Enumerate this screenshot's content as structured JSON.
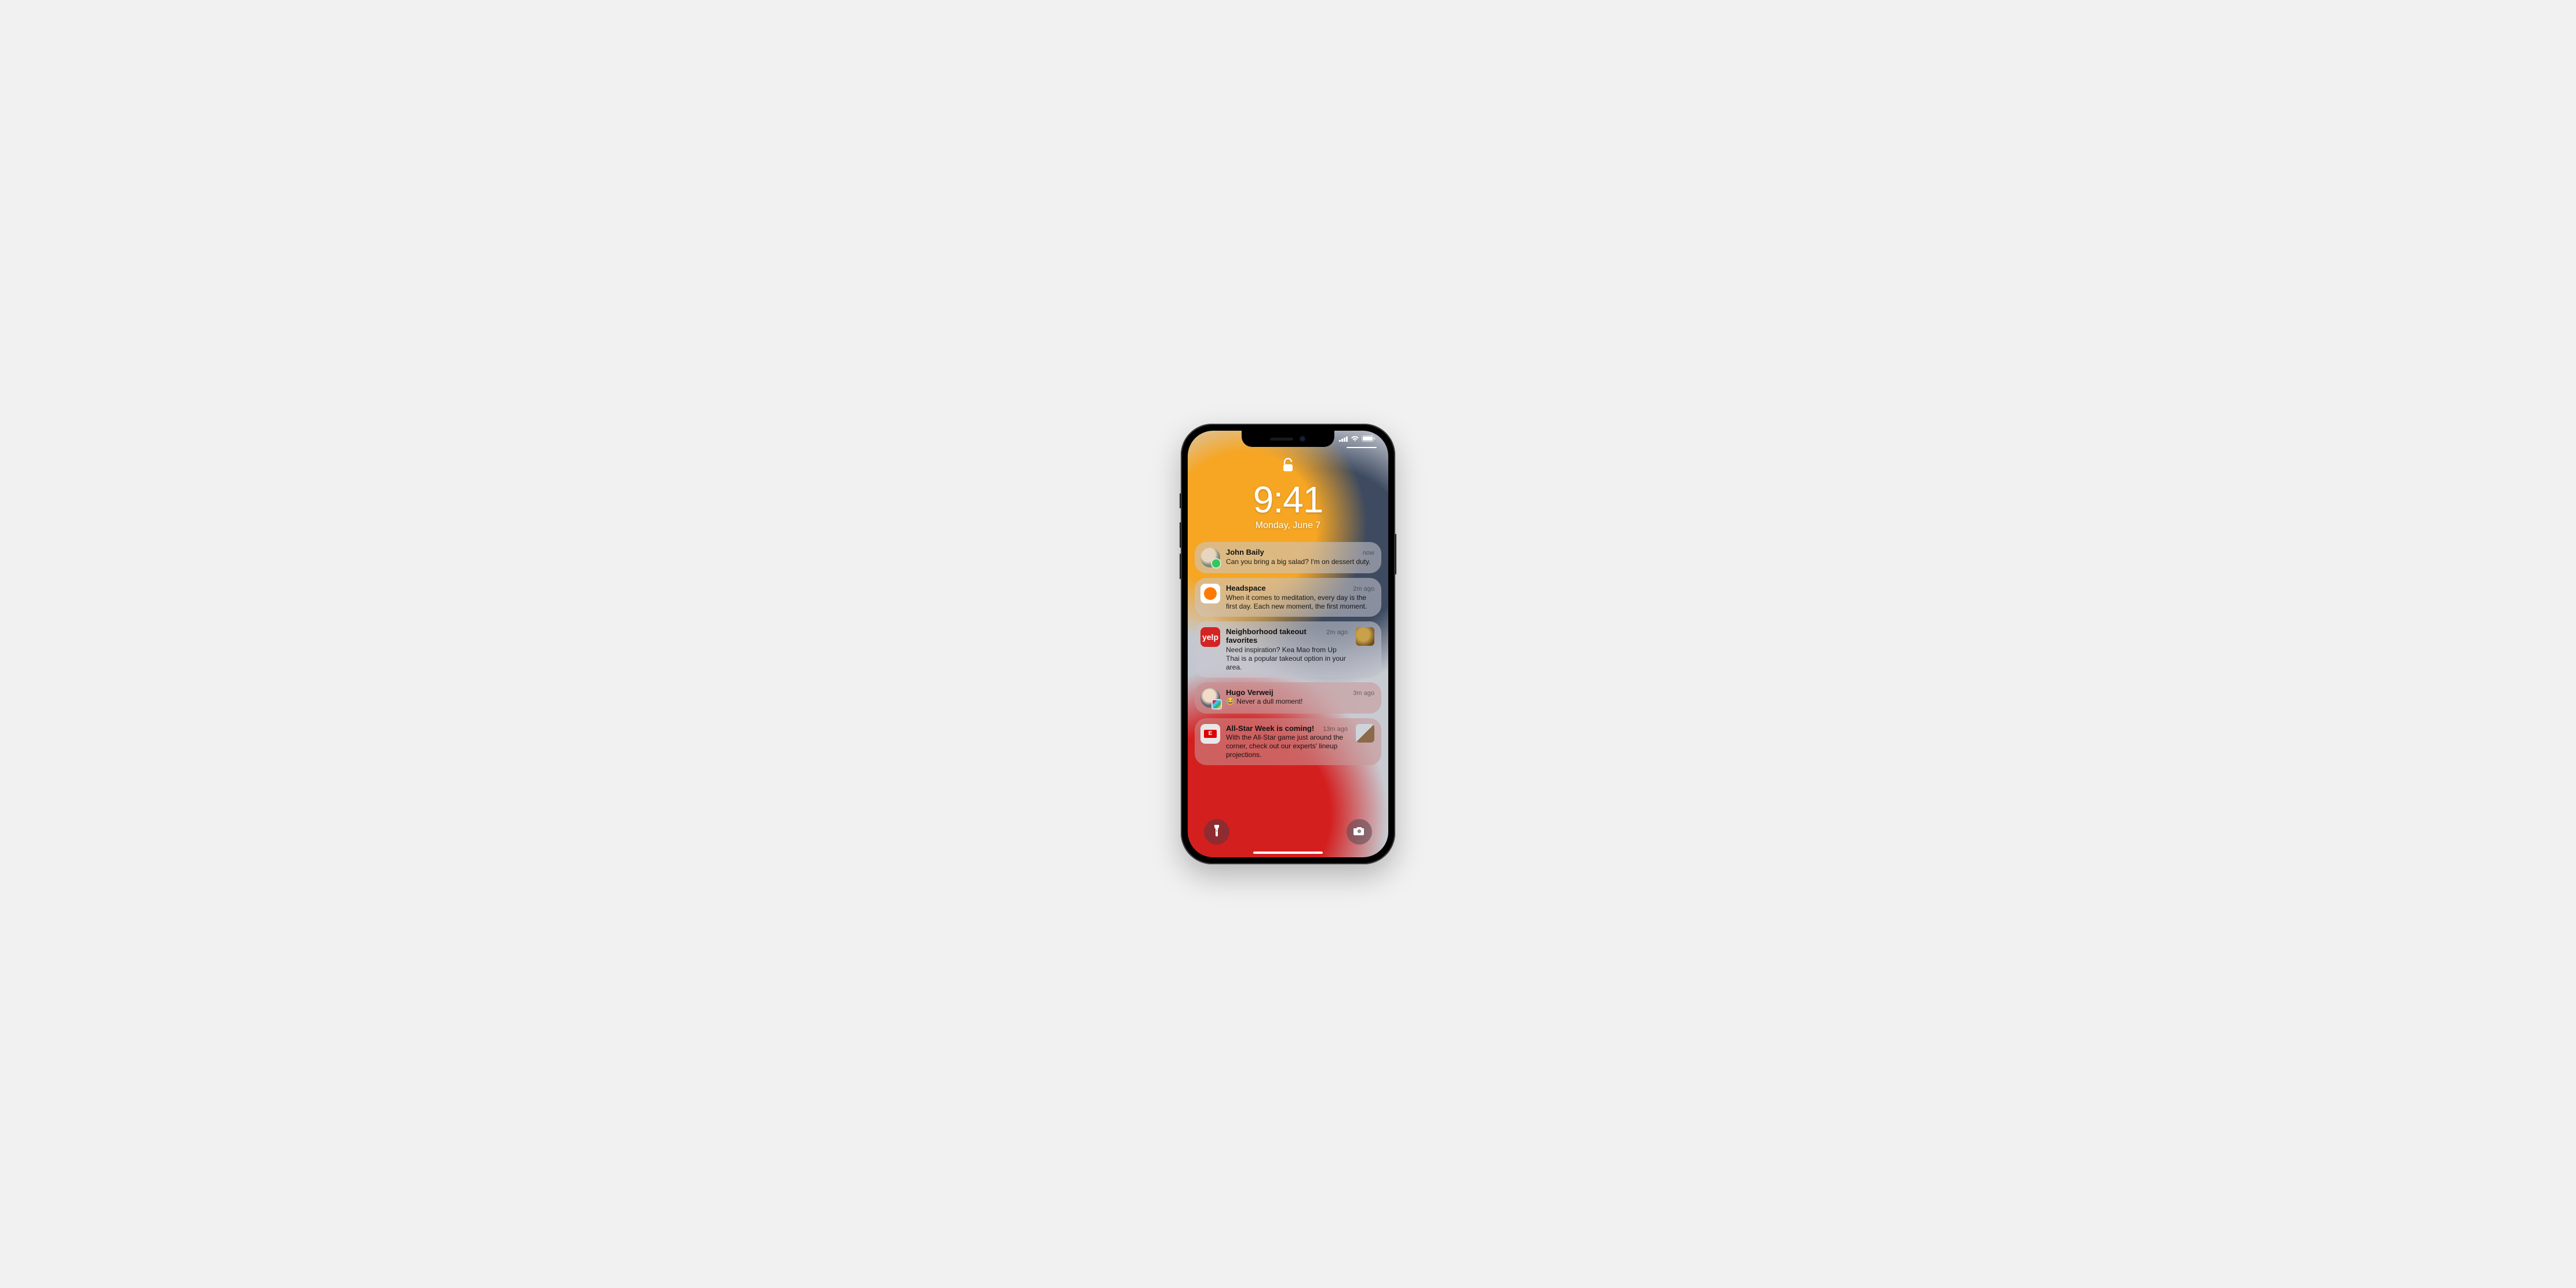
{
  "status": {
    "signal_icon": "cellular-signal-icon",
    "wifi_icon": "wifi-icon",
    "battery_icon": "battery-icon"
  },
  "lock": {
    "time": "9:41",
    "date": "Monday, June 7"
  },
  "notifications": [
    {
      "app_name": "Messages",
      "icon_name": "messages-avatar-icon",
      "title": "John Baily",
      "body": "Can you bring a big salad? I'm on dessert duty.",
      "time": "now",
      "has_thumb": false
    },
    {
      "app_name": "Headspace",
      "icon_name": "headspace-icon",
      "title": "Headspace",
      "body": "When it comes to meditation, every day is the first day. Each new moment, the first moment.",
      "time": "2m ago",
      "has_thumb": false
    },
    {
      "app_name": "Yelp",
      "icon_name": "yelp-icon",
      "icon_label": "yelp",
      "title": "Neighborhood takeout favorites",
      "body": "Need inspiration? Kea Mao from Up Thai is a popular takeout option in your area.",
      "time": "2m ago",
      "has_thumb": true,
      "thumb_name": "food-thumbnail"
    },
    {
      "app_name": "Slack",
      "icon_name": "slack-avatar-icon",
      "title": "Hugo Verweij",
      "body": "😂 Never a dull moment!",
      "time": "3m ago",
      "has_thumb": false
    },
    {
      "app_name": "ESPN",
      "icon_name": "espn-icon",
      "title": "All-Star Week is coming!",
      "body": "With the All-Star game just around the corner, check out our experts' lineup projections.",
      "time": "13m ago",
      "has_thumb": true,
      "thumb_name": "sports-thumbnail"
    }
  ],
  "bottom": {
    "flashlight_icon": "flashlight-icon",
    "camera_icon": "camera-icon"
  }
}
